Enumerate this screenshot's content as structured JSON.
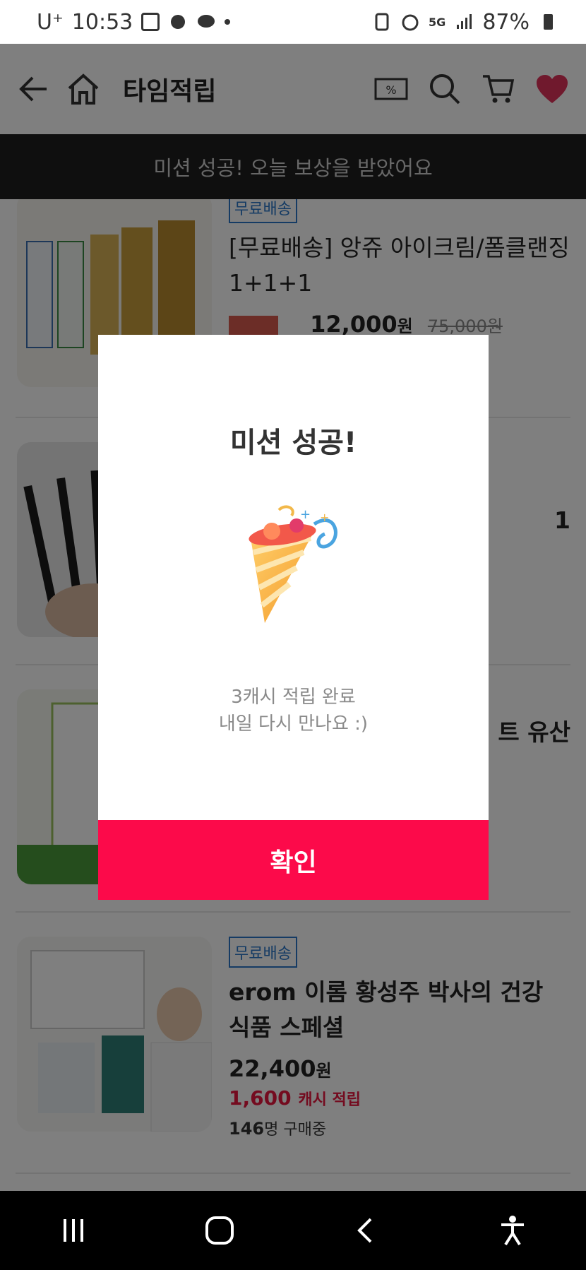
{
  "status_bar": {
    "carrier": "U⁺",
    "time": "10:53",
    "network": "5G",
    "battery": "87%"
  },
  "header": {
    "title": "타임적립",
    "coupon_badge": "%"
  },
  "banner": {
    "text": "미션 성공! 오늘 보상을 받았어요"
  },
  "products": [
    {
      "badge": "무료배송",
      "name": "[무료배송] 앙쥬 아이크림/폼클랜징 1+1+1",
      "price": "12,000",
      "price_unit": "원",
      "original_price": "75,000원"
    },
    {
      "name_fragment": "1"
    },
    {
      "name_fragment": "트 유산"
    },
    {
      "badge": "무료배송",
      "name": "erom 이롬 황성주 박사의 건강 식품 스페셜",
      "price": "22,400",
      "price_unit": "원",
      "cash": "1,600",
      "cash_label": "캐시 적립",
      "buyers_count": "146",
      "buyers_label": "명 구매중"
    }
  ],
  "modal": {
    "title": "미션 성공!",
    "message_line1": "3캐시 적립 완료",
    "message_line2": "내일 다시 만나요 :)",
    "confirm_label": "확인"
  },
  "colors": {
    "accent": "#fc0a4a",
    "badge_blue": "#2b77c9",
    "banner_bg": "#1f1f1f",
    "heart": "#e0335a"
  }
}
